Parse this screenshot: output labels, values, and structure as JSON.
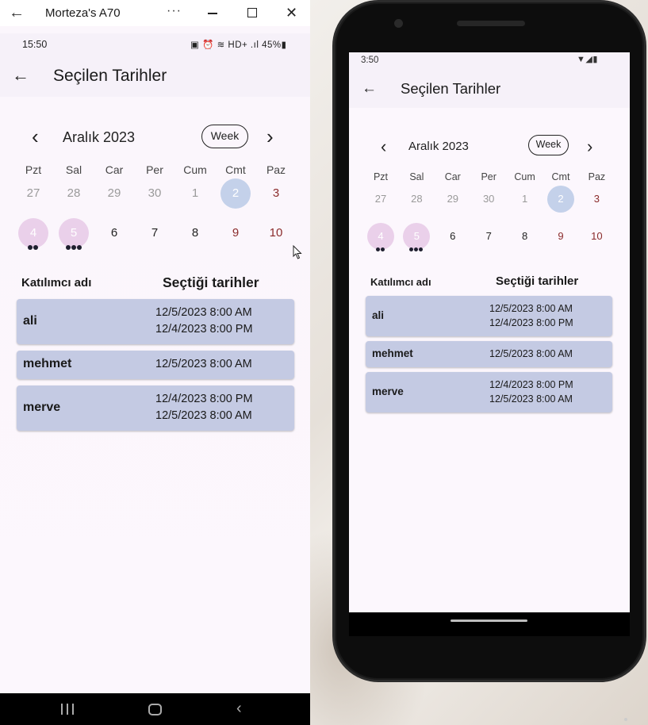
{
  "window": {
    "title": "Morteza's A70"
  },
  "status_left": {
    "time": "15:50",
    "icons": "▣ ⏰ ≋ HD+ .ıl 45%▮"
  },
  "status_right": {
    "time": "3:50",
    "icons": "▼◢▮"
  },
  "app": {
    "title": "Seçilen Tarihler"
  },
  "calendar": {
    "month": "Aralık 2023",
    "format_button": "Week",
    "weekdays": [
      "Pzt",
      "Sal",
      "Car",
      "Per",
      "Cum",
      "Cmt",
      "Paz"
    ],
    "week1": [
      {
        "label": "27",
        "state": "muted"
      },
      {
        "label": "28",
        "state": "muted"
      },
      {
        "label": "29",
        "state": "muted"
      },
      {
        "label": "30",
        "state": "muted"
      },
      {
        "label": "1",
        "state": "muted"
      },
      {
        "label": "2",
        "state": "today"
      },
      {
        "label": "3",
        "state": "sunday"
      }
    ],
    "week2": [
      {
        "label": "4",
        "state": "marked",
        "markers": 2
      },
      {
        "label": "5",
        "state": "marked",
        "markers": 3
      },
      {
        "label": "6",
        "state": "normal"
      },
      {
        "label": "7",
        "state": "normal"
      },
      {
        "label": "8",
        "state": "normal"
      },
      {
        "label": "9",
        "state": "sunday"
      },
      {
        "label": "10",
        "state": "sunday"
      }
    ]
  },
  "table": {
    "col_name": "Katılımcı adı",
    "col_dates": "Seçtiği tarihler",
    "rows": [
      {
        "name": "ali",
        "dates": [
          "12/5/2023 8:00 AM",
          "12/4/2023 8:00 PM"
        ]
      },
      {
        "name": "mehmet",
        "dates": [
          "12/5/2023 8:00 AM"
        ]
      },
      {
        "name": "merve",
        "dates": [
          "12/4/2023 8:00 PM",
          "12/5/2023 8:00 AM"
        ]
      }
    ]
  },
  "colors": {
    "today": "#c4d1ea",
    "marked": "#ead0ea",
    "card": "#c4cae3",
    "sunday": "#8b2c2c"
  }
}
